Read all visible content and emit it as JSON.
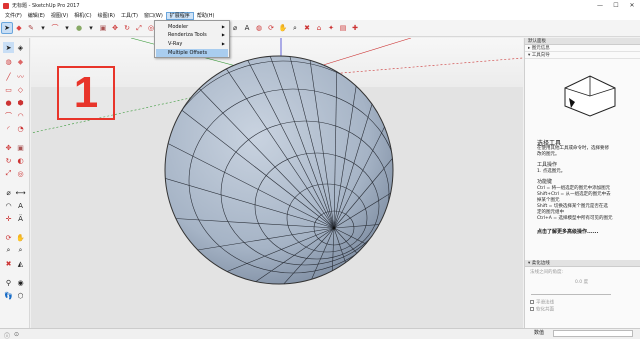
{
  "window": {
    "title": "无标题 - SketchUp Pro 2017",
    "controls": [
      "—",
      "☐",
      "✕"
    ]
  },
  "menu": [
    "文件(F)",
    "编辑(E)",
    "视图(V)",
    "相机(C)",
    "绘图(R)",
    "工具(T)",
    "窗口(W)",
    "扩展程序",
    "帮助(H)"
  ],
  "extensions_menu": {
    "items": [
      {
        "label": "Modeler",
        "submenu": true
      },
      {
        "label": "Renderiza Tools",
        "submenu": true
      },
      {
        "label": "V-Ray",
        "submenu": true
      },
      {
        "label": "Multiple Offsets",
        "submenu": false
      }
    ],
    "highlighted": "Multiple Offsets"
  },
  "annotation": {
    "label": "1",
    "color": "#e8342a"
  },
  "right_panel": {
    "tray_title": "默认面板",
    "sections": [
      "图元信息",
      "工具向导"
    ],
    "tool_title": "选择工具",
    "tool_desc_1": "在使用其他工具或命令时，选择要修",
    "tool_desc_2": "改的图元。",
    "ops_heading": "工具操作",
    "ops_1": "1. 点选图元。",
    "keys_heading": "功能键",
    "keys": [
      "Ctrl = 将一组选定的图元中添加图元",
      "Shift+Ctrl = 从一组选定的图元中去",
      "掉某个图元",
      "Shift = 切换选择某个图元是否在选",
      "定的图元组中",
      "Ctrl+A = 选择模型中所有可见的图元"
    ],
    "more_link": "点击了解更多高级操作......",
    "soften_title": "柔化边线",
    "soften_angle_label": "法线之间的角度:",
    "soften_angle_value": "0.0 度",
    "soften_opt_1": "平滑法线",
    "soften_opt_2": "软化共面"
  },
  "status": {
    "measurements_label": "数值"
  }
}
